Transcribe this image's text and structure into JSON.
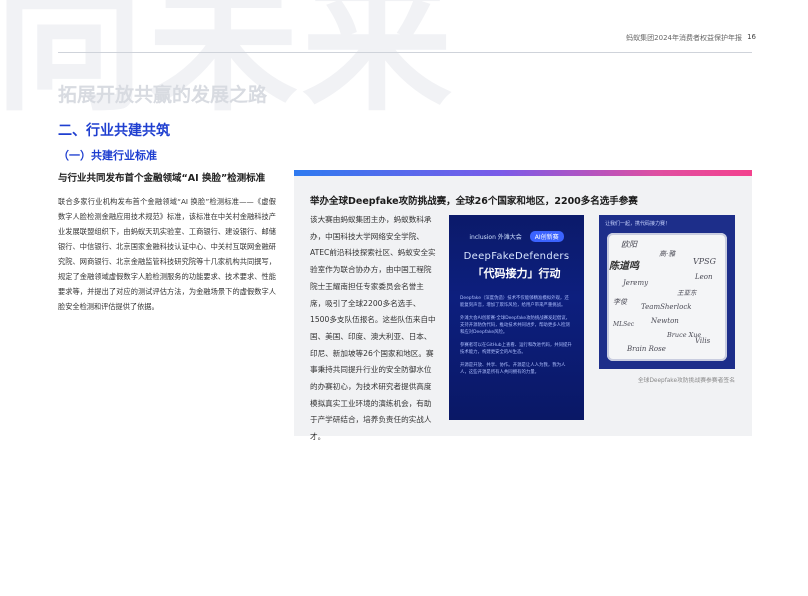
{
  "watermark": "向未来",
  "header": {
    "report_title": "蚂蚁集团2024年消费者权益保护年报",
    "page_number": "16"
  },
  "chapter_title": "拓展开放共赢的发展之路",
  "section_title": "二、行业共建共筑",
  "subsection_title": "（一）共建行业标准",
  "article": {
    "title": "与行业共同发布首个金融领域“AI 换脸”检测标准",
    "body": "联合多家行业机构发布首个金融领域“AI 换脸”检测标准——《虚假数字人脸检测金融应用技术规范》标准，该标准在中关村金融科技产业发展联盟组织下，由蚂蚁天玑实验室、工商银行、建设银行、邮储银行、中信银行、北京国家金融科技认证中心、中关村互联网金融研究院、网商银行、北京金融监管科技研究院等十几家机构共同撰写，规定了金融领域虚假数字人脸检测服务的功能要求、技术要求、性能要求等，并提出了对应的测试评估方法，为金融场景下的虚假数字人脸安全检测和评估提供了依据。"
  },
  "case": {
    "title": "举办全球Deepfake攻防挑战赛，全球26个国家和地区，2200多名选手参赛",
    "body": "该大赛由蚂蚁集团主办，蚂蚁数科承办，中国科技大学网络安全学院、ATEC前沿科技探索社区、蚂蚁安全实验室作为联合协办方，由中国工程院院士王耀南担任专家委员会名誉主席，吸引了全球2200多名选手、1500多支队伍报名。这些队伍来自中国、美国、印度、澳大利亚、日本、印尼、新加坡等26个国家和地区。赛事秉持共同提升行业的安全防御水位的办赛初心，为技术研究者提供高度模拟真实工业环境的演练机会，有助于产学研结合，培养负责任的实战人才。"
  },
  "poster": {
    "logo_text": "inclusion 外滩大会",
    "badge_text": "AI创新赛",
    "event_name": "DeepFakeDefenders",
    "tagline": "「代码接力」行动",
    "paragraphs": [
      "Deepfake（深度伪造）技术不仅能够精准模拟外观，还能复刻声音，增加了欺诈风险，给用户带来严重挑战。",
      "外滩大会AI创新赛·全球Deepfake攻防挑战赛发起倡议，支持开源防伪代码，推动技术共同进步，帮助更多人检测和应对Deepfake风险。",
      "参赛者可以在GitHub上查看、运行和改进代码，共同提升技术能力，构建更安全的AI生态。",
      "开源是开放、共享、协作。开源是让人人为我，我为人人，这些开源是所有人共同拥有的力量。"
    ]
  },
  "signatures": {
    "prompt": "让我们一起，携代码接力赛！",
    "names": [
      "欧阳",
      "陈道鸣",
      "高·雅",
      "VPSG",
      "Leon",
      "Jeremy",
      "王亚东",
      "李俊",
      "TeamSherlock",
      "Newton",
      "MLSec",
      "Bruce Xue",
      "Brain Rose",
      "Vilis"
    ],
    "caption": "全球Deepfake攻防挑战赛参赛者签名"
  }
}
